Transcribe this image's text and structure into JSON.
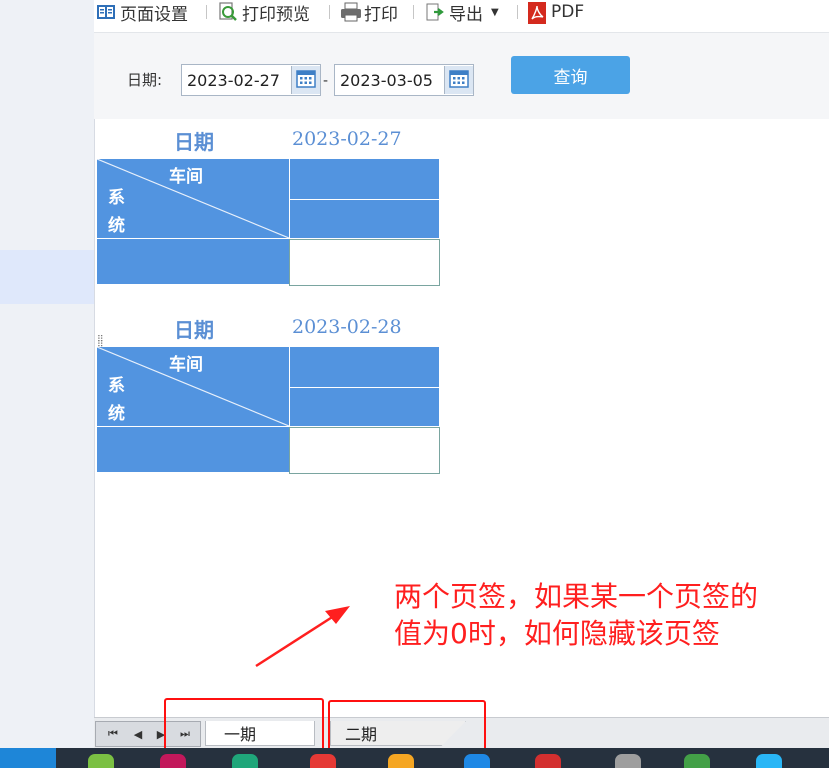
{
  "toolbar": {
    "page_setup": "页面设置",
    "print_preview": "打印预览",
    "print": "打印",
    "export": "导出",
    "pdf": "PDF"
  },
  "query": {
    "date_label": "日期:",
    "start_date": "2023-02-27",
    "separator": "-",
    "end_date": "2023-03-05",
    "query_button": "查询"
  },
  "reports": [
    {
      "label": "日期",
      "date": "2023-02-27",
      "header_top": "车间",
      "header_bottom_1": "系",
      "header_bottom_2": "统"
    },
    {
      "label": "日期",
      "date": "2023-02-28",
      "header_top": "车间",
      "header_bottom_1": "系",
      "header_bottom_2": "统"
    }
  ],
  "annotation": {
    "line1": "两个页签，如果某一个页签的",
    "line2": "值为0时，如何隐藏该页签"
  },
  "sheet_tabs": [
    {
      "label": "一期"
    },
    {
      "label": "二期"
    }
  ],
  "colors": {
    "header_blue": "#5294e0",
    "query_button": "#4ba3e6",
    "annotation_red": "#ff1f1f"
  }
}
